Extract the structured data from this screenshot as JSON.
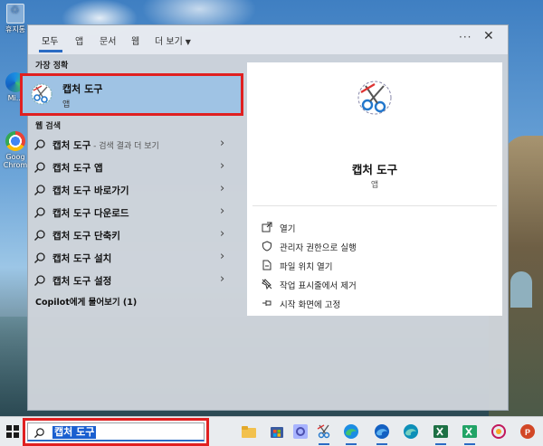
{
  "desktop": {
    "icons": [
      {
        "label": "휴지통"
      },
      {
        "label": "Mi..."
      },
      {
        "label": "Goog\nChrom"
      }
    ]
  },
  "search_panel": {
    "scopes": [
      {
        "label": "모두",
        "active": true
      },
      {
        "label": "앱"
      },
      {
        "label": "문서"
      },
      {
        "label": "웹"
      },
      {
        "label": "더 보기"
      }
    ],
    "more_label": "···",
    "close_label": "✕",
    "best_match_heading": "가장 정확",
    "best_match": {
      "name": "캡처 도구",
      "type": "앱"
    },
    "web_heading": "웹 검색",
    "web_results": [
      {
        "main": "캡처 도구",
        "sub": " - 검색 결과 더 보기"
      },
      {
        "main": "캡처 도구 앱",
        "sub": ""
      },
      {
        "main": "캡처 도구 바로가기",
        "sub": ""
      },
      {
        "main": "캡처 도구 다운로드",
        "sub": ""
      },
      {
        "main": "캡처 도구 단축키",
        "sub": ""
      },
      {
        "main": "캡처 도구 설치",
        "sub": ""
      },
      {
        "main": "캡처 도구 설정",
        "sub": ""
      }
    ],
    "copilot_label": "Copilot에게 물어보기 (1)",
    "detail": {
      "name": "캡처 도구",
      "type": "앱",
      "actions": [
        {
          "label": "열기",
          "icon": "open-icon"
        },
        {
          "label": "관리자 권한으로 실행",
          "icon": "admin-shield-icon"
        },
        {
          "label": "파일 위치 열기",
          "icon": "file-location-icon"
        },
        {
          "label": "작업 표시줄에서 제거",
          "icon": "unpin-icon"
        },
        {
          "label": "시작 화면에 고정",
          "icon": "pin-icon"
        }
      ]
    }
  },
  "taskbar": {
    "search_query": "캡처 도구",
    "pinned": [
      "file-explorer-icon",
      "store-icon",
      "settings-icon",
      "snipping-tool-icon",
      "edge-icon",
      "edge-beta-icon",
      "edge-dev-icon",
      "excel-icon",
      "excel-icon",
      "search-app-icon",
      "powerpoint-icon"
    ]
  },
  "colors": {
    "highlight_border": "#e02020",
    "selection": "#9fc3e4",
    "accent": "#2a6bc4"
  }
}
